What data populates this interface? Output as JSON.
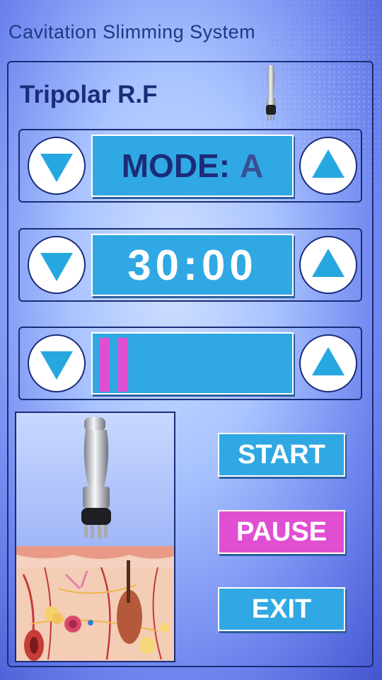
{
  "app": {
    "title": "Cavitation Slimming System"
  },
  "panel": {
    "section_title": "Tripolar R.F"
  },
  "controls": {
    "mode": {
      "label": "MODE:",
      "value": "A"
    },
    "timer": {
      "value": "30:00"
    },
    "intensity": {
      "level_segments": 2
    }
  },
  "actions": {
    "start": "START",
    "pause": "PAUSE",
    "exit": "EXIT"
  },
  "colors": {
    "accent_blue": "#30a8e3",
    "accent_pink": "#e04fd2",
    "navy": "#1b2c78"
  },
  "icons": {
    "decrease": "triangle-down-icon",
    "increase": "triangle-up-icon",
    "handpiece": "rf-handpiece-image",
    "skin": "skin-cross-section-image"
  }
}
